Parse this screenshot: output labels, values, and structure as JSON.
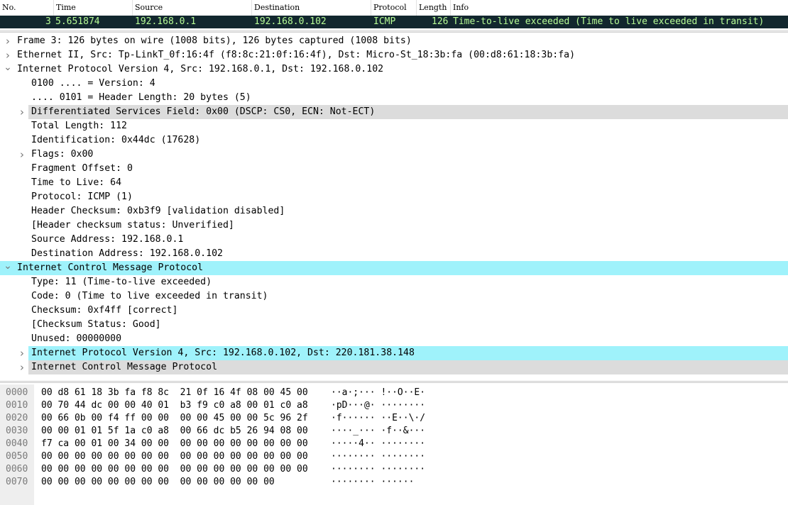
{
  "packet_list": {
    "columns": [
      "No.",
      "Time",
      "Source",
      "Destination",
      "Protocol",
      "Length",
      "Info"
    ],
    "selected": {
      "no": "3",
      "time": "5.651874",
      "source": "192.168.0.1",
      "destination": "192.168.0.102",
      "protocol": "ICMP",
      "length": "126",
      "info": "Time-to-live exceeded (Time to live exceeded in transit)",
      "bg_color": "#12272e",
      "fg_color": "#b7fc96"
    }
  },
  "details": [
    {
      "text": "Frame 3: 126 bytes on wire (1008 bits), 126 bytes captured (1008 bits)",
      "arrow": "collapsed"
    },
    {
      "text": "Ethernet II, Src: Tp-LinkT_0f:16:4f (f8:8c:21:0f:16:4f), Dst: Micro-St_18:3b:fa (00:d8:61:18:3b:fa)",
      "arrow": "collapsed"
    },
    {
      "text": "Internet Protocol Version 4, Src: 192.168.0.1, Dst: 192.168.0.102",
      "arrow": "expanded"
    },
    {
      "text": "0100 .... = Version: 4",
      "arrow": "none"
    },
    {
      "text": ".... 0101 = Header Length: 20 bytes (5)",
      "arrow": "none"
    },
    {
      "text": "Differentiated Services Field: 0x00 (DSCP: CS0, ECN: Not-ECT)",
      "arrow": "collapsed",
      "highlight": "grey"
    },
    {
      "text": "Total Length: 112",
      "arrow": "none"
    },
    {
      "text": "Identification: 0x44dc (17628)",
      "arrow": "none"
    },
    {
      "text": "Flags: 0x00",
      "arrow": "collapsed"
    },
    {
      "text": "Fragment Offset: 0",
      "arrow": "none"
    },
    {
      "text": "Time to Live: 64",
      "arrow": "none"
    },
    {
      "text": "Protocol: ICMP (1)",
      "arrow": "none"
    },
    {
      "text": "Header Checksum: 0xb3f9 [validation disabled]",
      "arrow": "none"
    },
    {
      "text": "[Header checksum status: Unverified]",
      "arrow": "none"
    },
    {
      "text": "Source Address: 192.168.0.1",
      "arrow": "none"
    },
    {
      "text": "Destination Address: 192.168.0.102",
      "arrow": "none"
    },
    {
      "text": "Internet Control Message Protocol",
      "arrow": "expanded",
      "highlight": "cyan"
    },
    {
      "text": "Type: 11 (Time-to-live exceeded)",
      "arrow": "none"
    },
    {
      "text": "Code: 0 (Time to live exceeded in transit)",
      "arrow": "none"
    },
    {
      "text": "Checksum: 0xf4ff [correct]",
      "arrow": "none"
    },
    {
      "text": "[Checksum Status: Good]",
      "arrow": "none"
    },
    {
      "text": "Unused: 00000000",
      "arrow": "none"
    },
    {
      "text": "Internet Protocol Version 4, Src: 192.168.0.102, Dst: 220.181.38.148",
      "arrow": "collapsed",
      "highlight": "cyan"
    },
    {
      "text": "Internet Control Message Protocol",
      "arrow": "collapsed",
      "highlight": "grey"
    }
  ],
  "hex": [
    {
      "offset": "0000",
      "bytes": "00 d8 61 18 3b fa f8 8c  21 0f 16 4f 08 00 45 00",
      "ascii": "··a·;··· !··O··E·"
    },
    {
      "offset": "0010",
      "bytes": "00 70 44 dc 00 00 40 01  b3 f9 c0 a8 00 01 c0 a8",
      "ascii": "·pD···@· ········"
    },
    {
      "offset": "0020",
      "bytes": "00 66 0b 00 f4 ff 00 00  00 00 45 00 00 5c 96 2f",
      "ascii": "·f······ ··E··\\·/"
    },
    {
      "offset": "0030",
      "bytes": "00 00 01 01 5f 1a c0 a8  00 66 dc b5 26 94 08 00",
      "ascii": "····_··· ·f··&···"
    },
    {
      "offset": "0040",
      "bytes": "f7 ca 00 01 00 34 00 00  00 00 00 00 00 00 00 00",
      "ascii": "·····4·· ········"
    },
    {
      "offset": "0050",
      "bytes": "00 00 00 00 00 00 00 00  00 00 00 00 00 00 00 00",
      "ascii": "········ ········"
    },
    {
      "offset": "0060",
      "bytes": "00 00 00 00 00 00 00 00  00 00 00 00 00 00 00 00",
      "ascii": "········ ········"
    },
    {
      "offset": "0070",
      "bytes": "00 00 00 00 00 00 00 00  00 00 00 00 00 00",
      "ascii": "········ ······"
    }
  ],
  "colors": {
    "selected_row_bg": "#12272e",
    "selected_row_fg": "#b7fc96",
    "grey_highlight": "#dcdcdc",
    "cyan_highlight": "#9ff2fb"
  },
  "icons": {
    "collapsed": "chevron-right-icon",
    "expanded": "chevron-down-icon"
  }
}
